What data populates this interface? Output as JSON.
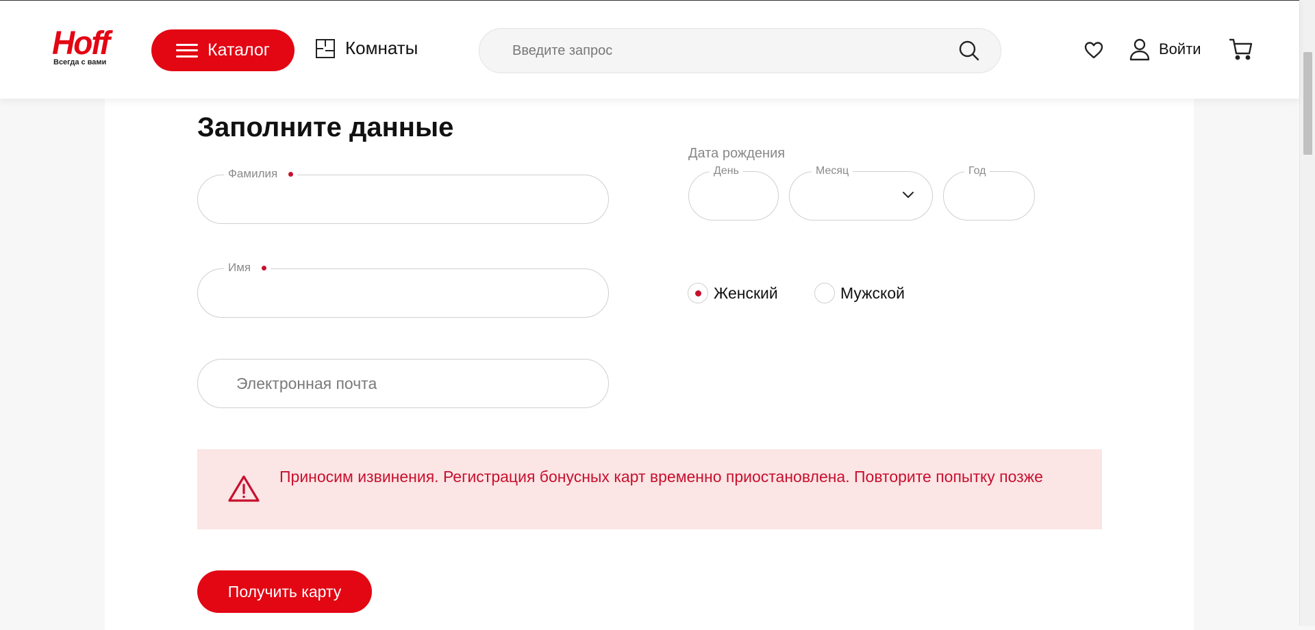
{
  "header": {
    "logo_text": "Hoff",
    "logo_tagline": "Всегда с вами",
    "catalog_label": "Каталог",
    "rooms_label": "Комнаты",
    "search_placeholder": "Введите запрос",
    "login_label": "Войти"
  },
  "form": {
    "title": "Заполните данные",
    "last_name_label": "Фамилия",
    "first_name_label": "Имя",
    "email_placeholder": "Электронная почта",
    "dob_title": "Дата рождения",
    "day_label": "День",
    "month_label": "Месяц",
    "year_label": "Год",
    "gender_female": "Женский",
    "gender_male": "Мужской",
    "selected_gender": "Женский",
    "alert_text": "Приносим извинения. Регистрация бонусных карт временно приостановлена. Повторите попытку позже",
    "submit_label": "Получить карту"
  },
  "colors": {
    "brand_red": "#e30613",
    "alert_bg": "#fbe5e5",
    "alert_text": "#c8102e"
  },
  "icons": [
    "menu-icon",
    "rooms-icon",
    "search-icon",
    "heart-icon",
    "user-icon",
    "cart-icon",
    "warning-icon",
    "chevron-down-icon"
  ]
}
